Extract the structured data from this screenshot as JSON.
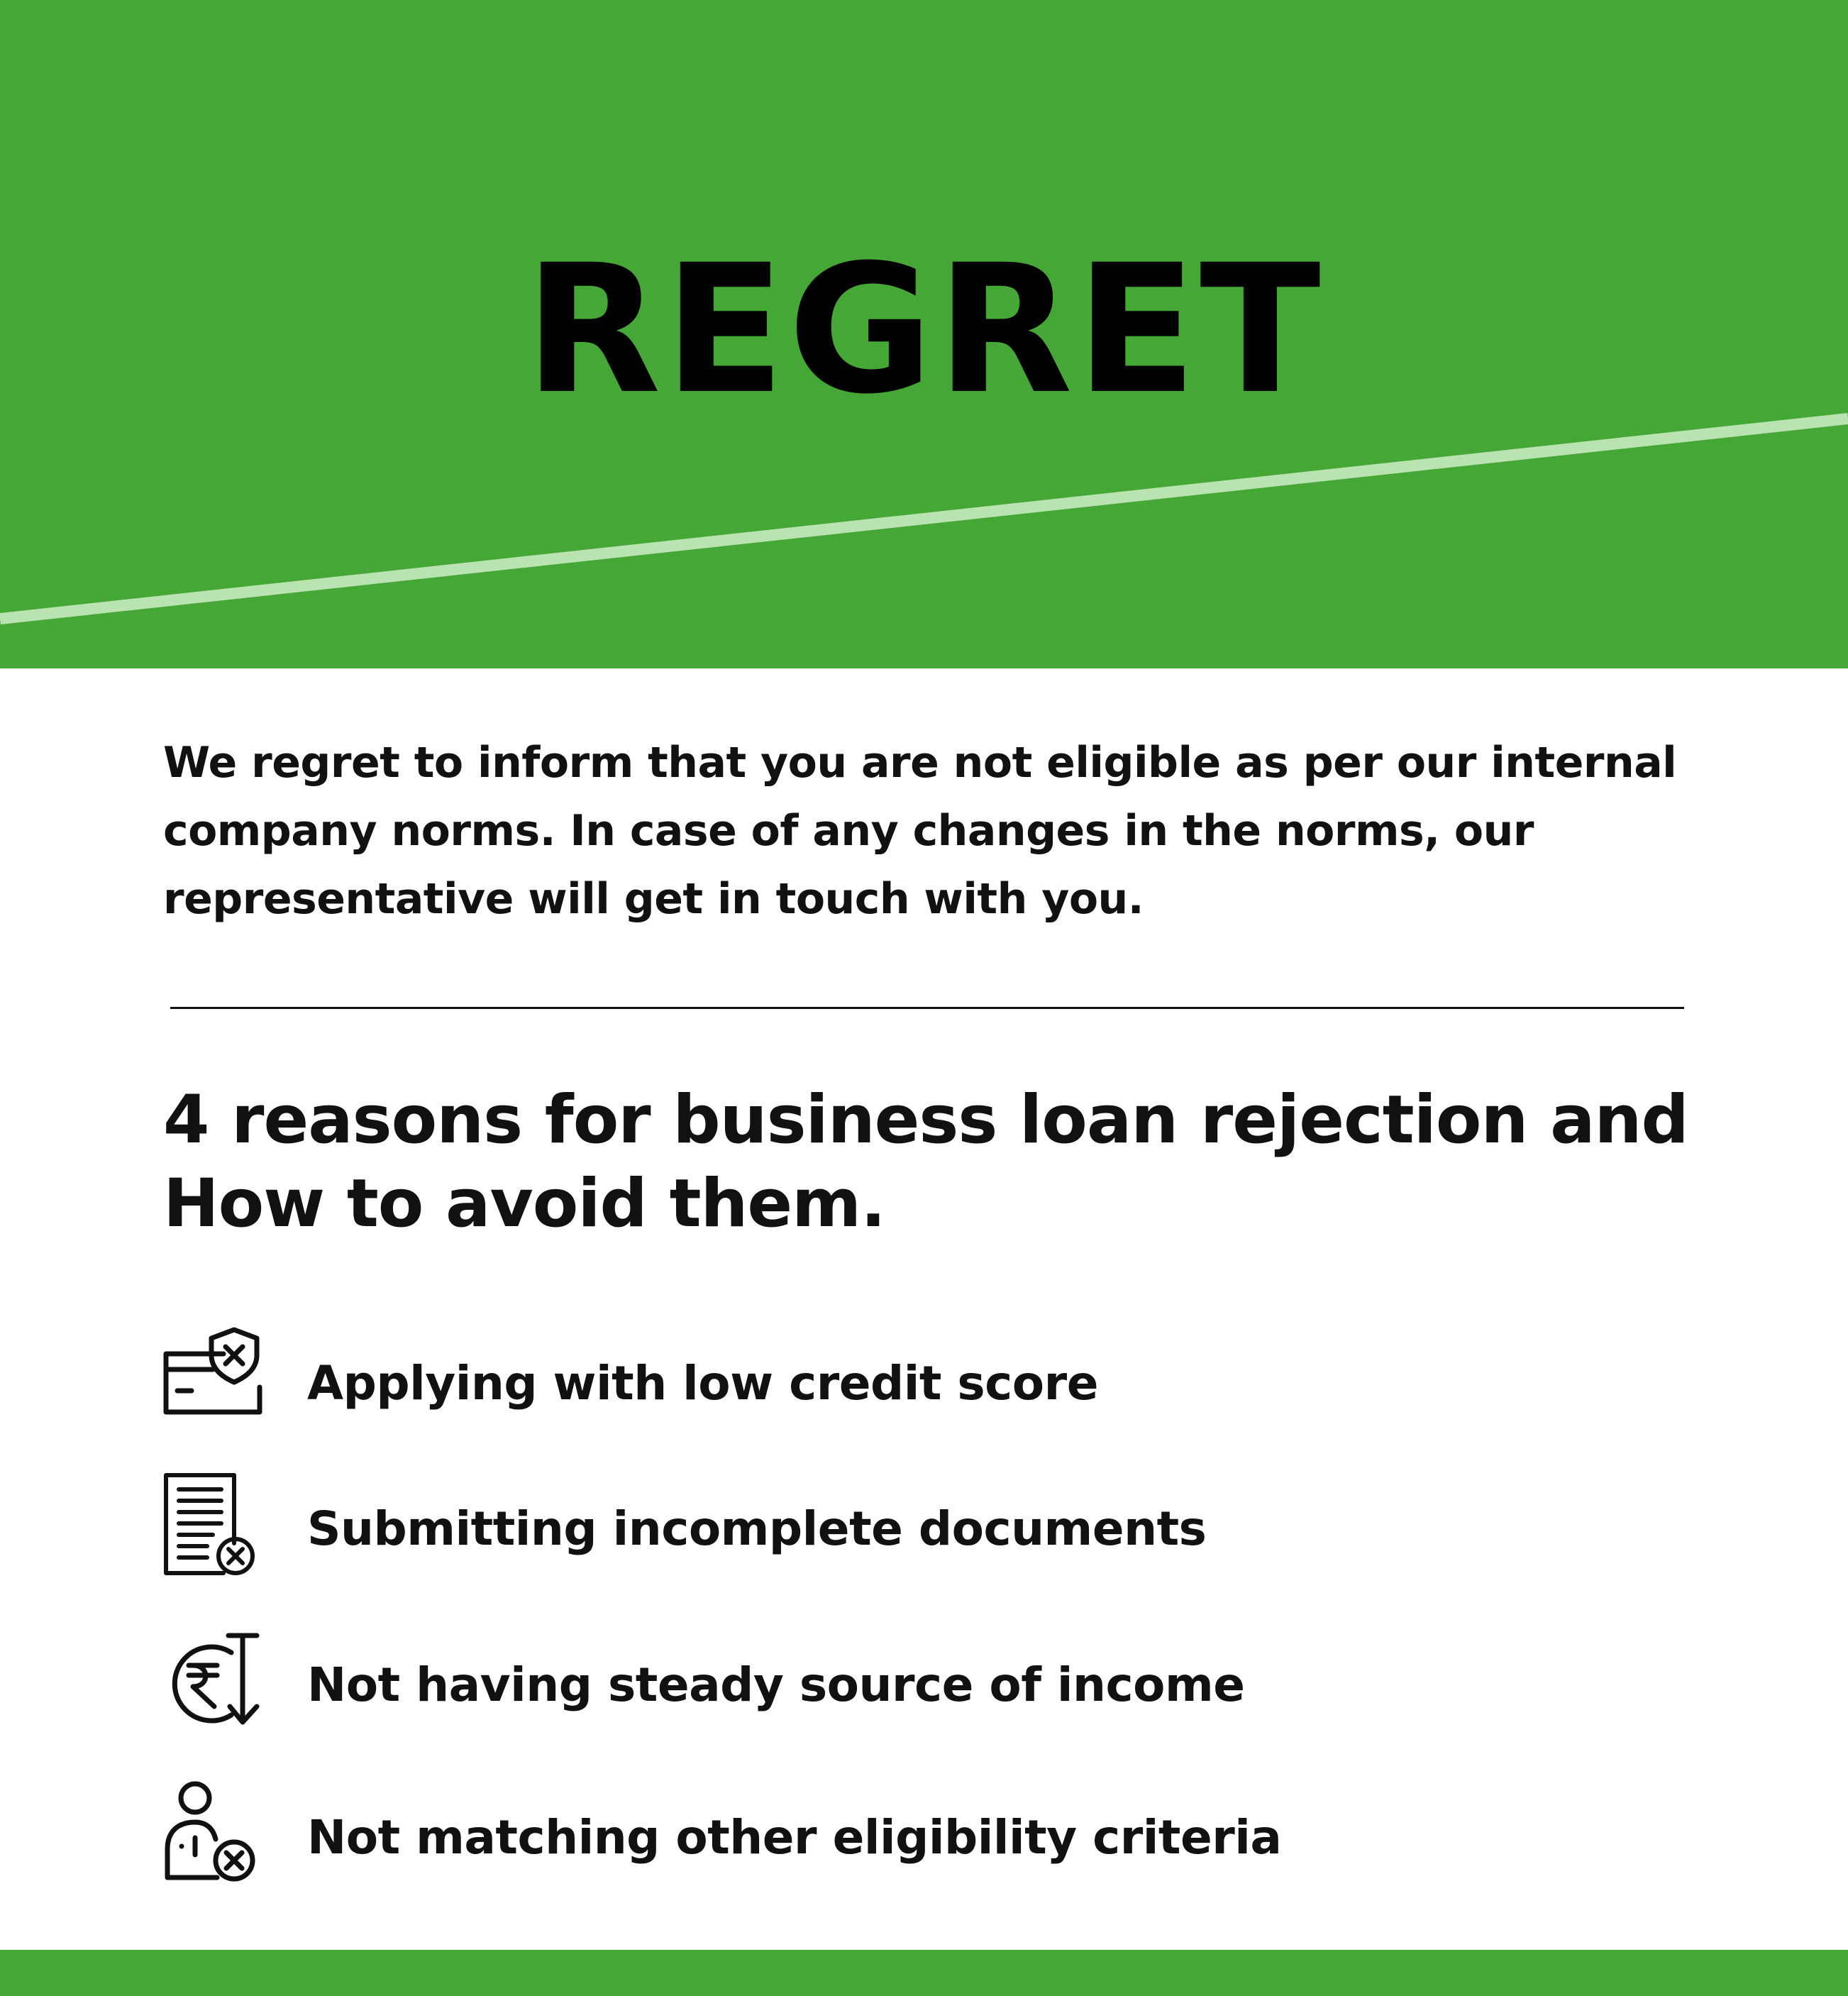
{
  "header": {
    "title": "REGRET"
  },
  "intro": {
    "text": "We regret to inform that you are not eligible as per our internal company norms. In case of any changes in the norms, our representative will get in touch with you."
  },
  "reasons_section": {
    "heading": "4 reasons for business loan rejection and How to avoid them.",
    "items": [
      {
        "label": "Applying with low credit score",
        "icon": "credit-card-shield-x-icon"
      },
      {
        "label": "Submitting incomplete documents",
        "icon": "document-x-icon"
      },
      {
        "label": "Not having steady source of income",
        "icon": "rupee-down-icon"
      },
      {
        "label": "Not matching other eligibility criteria",
        "icon": "person-x-icon"
      }
    ]
  },
  "colors": {
    "brand_green": "#45a735",
    "stripe": "#b9e3b0",
    "text": "#111111"
  }
}
